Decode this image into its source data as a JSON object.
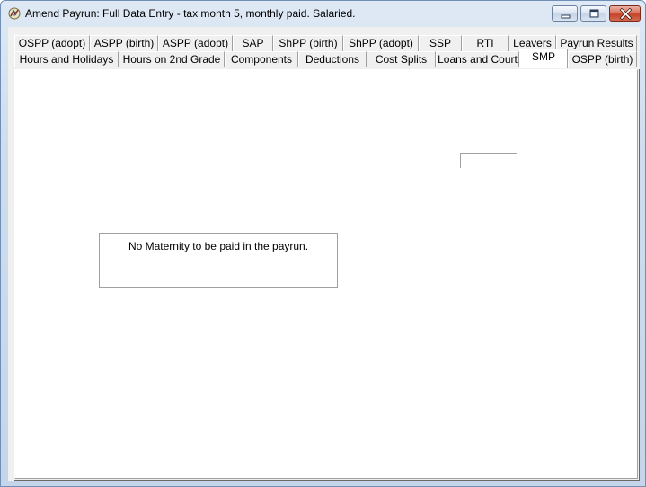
{
  "window": {
    "title": "Amend Payrun: Full Data Entry - tax month 5, monthly paid.  Salaried."
  },
  "title_controls": {
    "minimize_icon": "minimize-icon",
    "maximize_icon": "restore-icon",
    "close_icon": "close-icon"
  },
  "tabs": {
    "back_row": [
      {
        "label": "OSPP (adopt)"
      },
      {
        "label": "ASPP (birth)"
      },
      {
        "label": "ASPP (adopt)"
      },
      {
        "label": "SAP"
      },
      {
        "label": "ShPP (birth)"
      },
      {
        "label": "ShPP (adopt)"
      },
      {
        "label": "SSP"
      },
      {
        "label": "RTI"
      },
      {
        "label": "Leavers"
      },
      {
        "label": "Payrun Results"
      }
    ],
    "front_row": [
      {
        "label": "Hours and Holidays"
      },
      {
        "label": "Hours on 2nd Grade"
      },
      {
        "label": "Components"
      },
      {
        "label": "Deductions"
      },
      {
        "label": "Cost Splits"
      },
      {
        "label": "Loans and Court"
      },
      {
        "label": "SMP",
        "selected": true
      },
      {
        "label": "OSPP (birth)"
      }
    ]
  },
  "smp_page": {
    "message": "No Maternity to be paid in the payrun."
  },
  "colors": {
    "selected_tab": "#ffffff",
    "tab_background": "#f0f0f0",
    "close_button": "#c4432a"
  }
}
